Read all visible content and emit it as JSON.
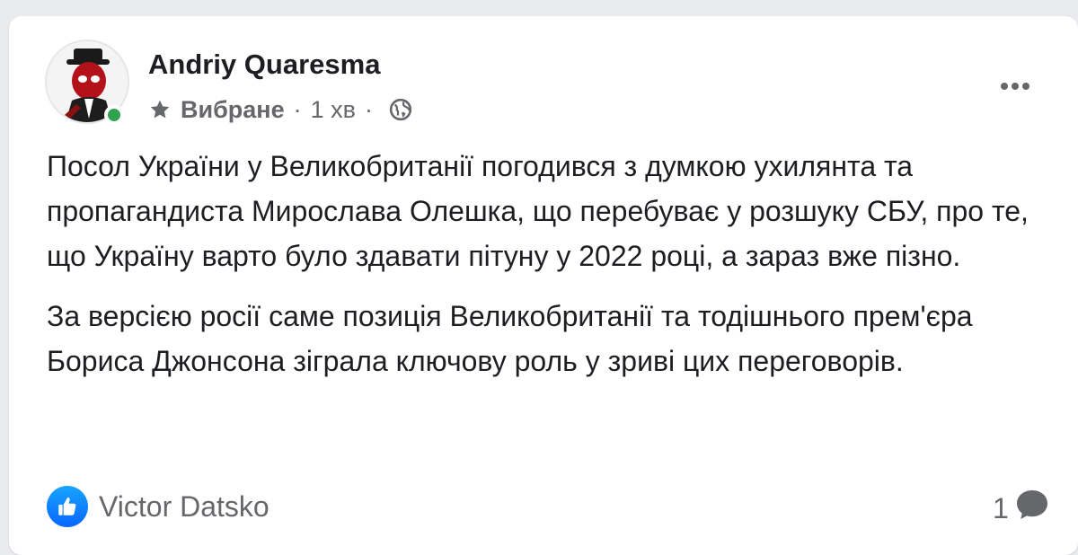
{
  "post": {
    "author": {
      "name": "Andriy Quaresma",
      "online": true
    },
    "meta": {
      "audience_label": "Вибране",
      "separator": "·",
      "time": "1 хв",
      "separator2": "·"
    },
    "paragraphs": [
      "Посол України у Великобританії погодився з думкою ухилянта та пропагандиста Мирослава Олешка, що перебуває у розшуку СБУ, про те, що Україну варто було здавати пітуну у 2022 році, а зараз вже пізно.",
      "За версією росії саме позиція Великобританії та тодішнього прем'єра Бориса Джонсона зіграла ключову роль у зриві цих переговорів."
    ],
    "reactions": {
      "icon": "like-icon",
      "name": "Victor Datsko"
    },
    "comments": {
      "count": "1",
      "icon": "comment-icon"
    }
  },
  "colors": {
    "like_blue": "#0866ff",
    "online_green": "#31a24c",
    "secondary_text": "#65676b",
    "primary_text": "#1c1e21"
  }
}
